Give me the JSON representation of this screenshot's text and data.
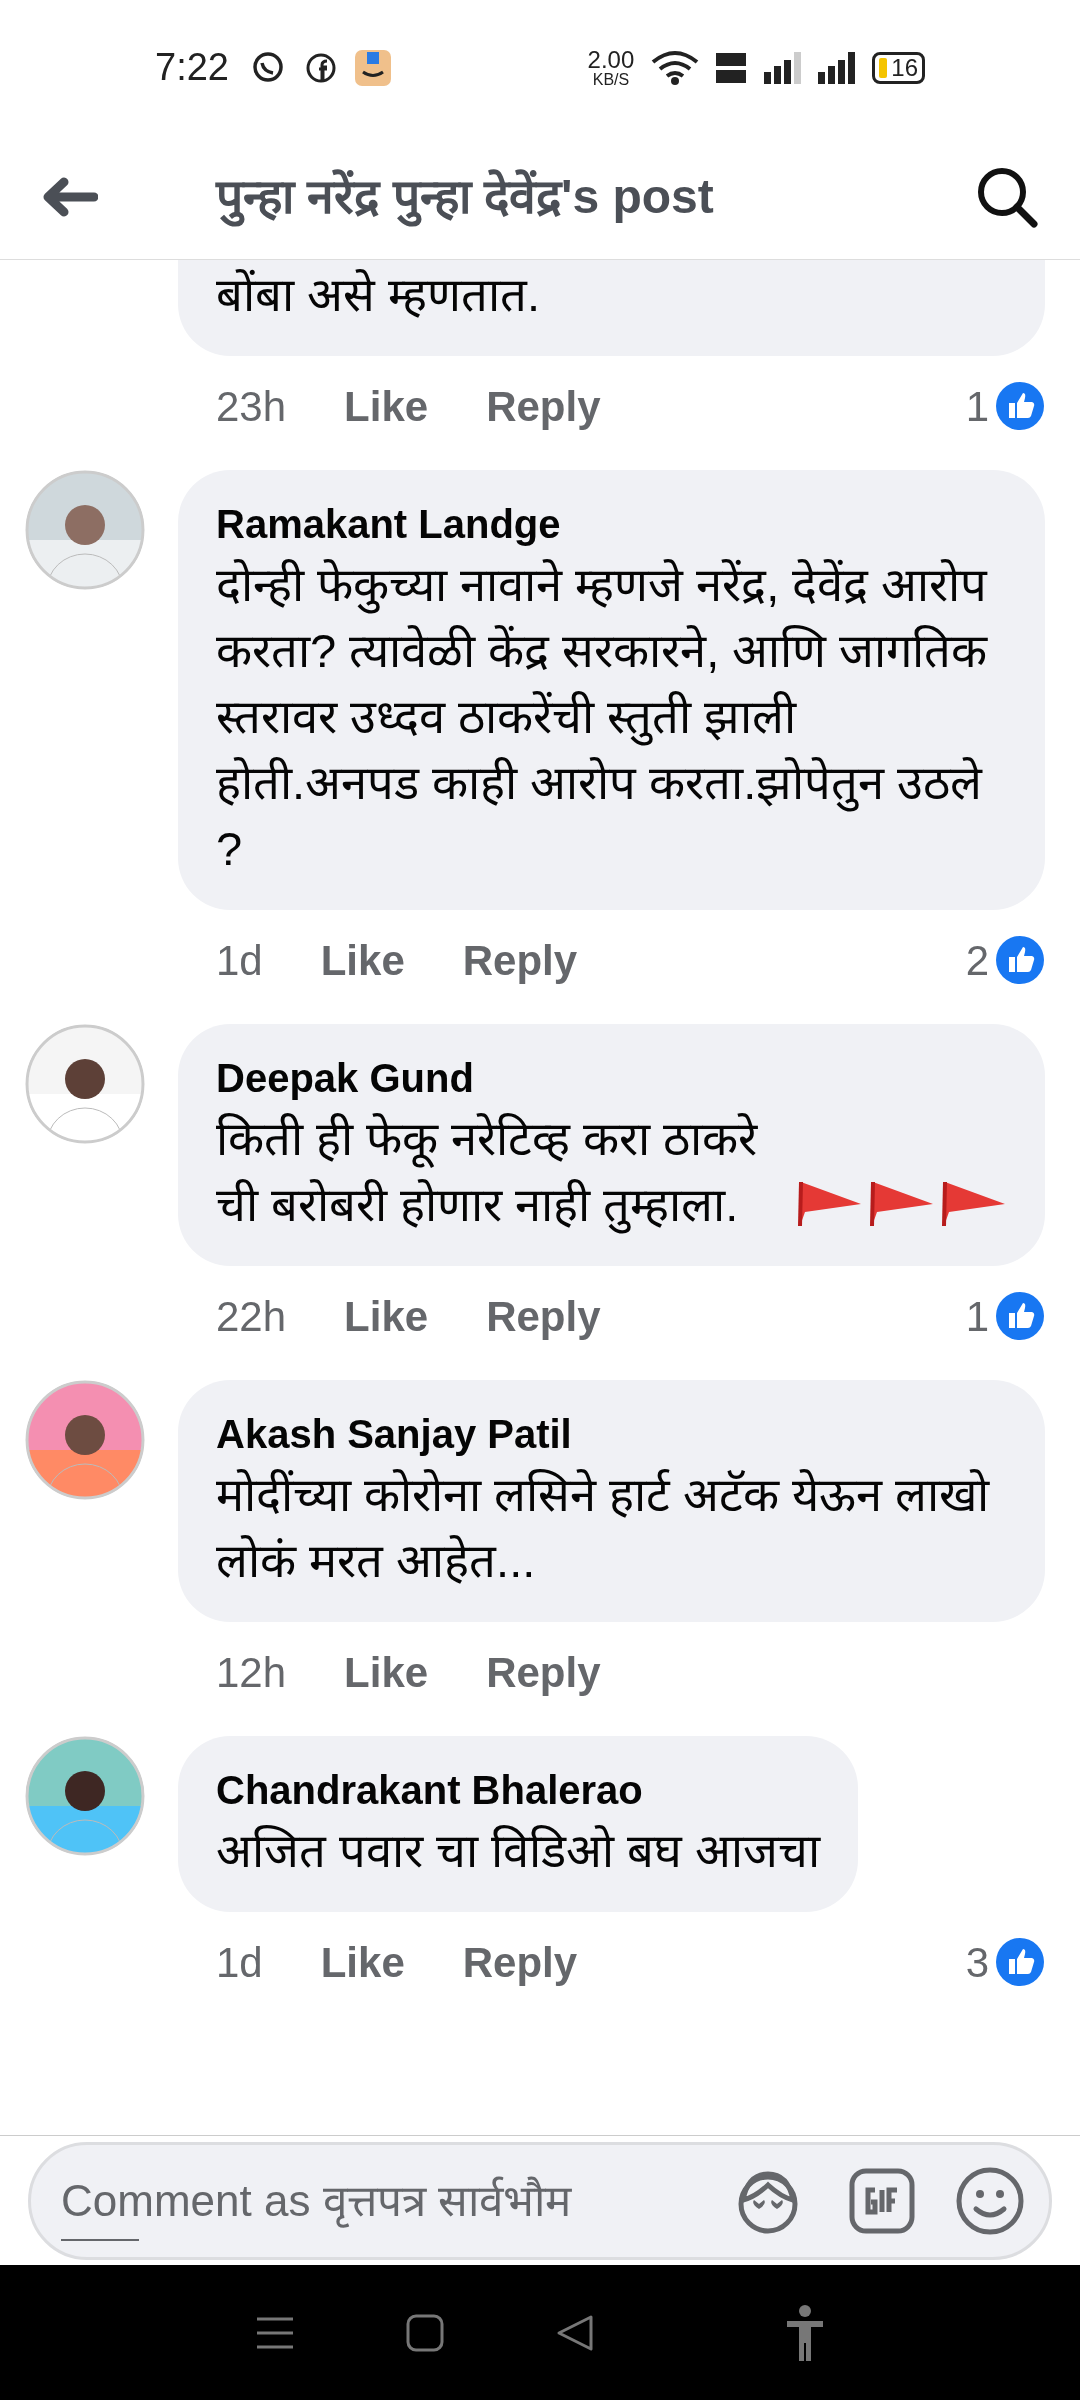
{
  "status_bar": {
    "time": "7:22",
    "speed": "2.00",
    "speed_unit": "KB/S",
    "battery": "16"
  },
  "header": {
    "title": "पुन्हा नरेंद्र पुन्हा देवेंद्र's post"
  },
  "comments": [
    {
      "text": "बोंबा असे म्हणतात.",
      "time": "23h",
      "like": "Like",
      "reply": "Reply",
      "likes": "1",
      "cut_top": true
    },
    {
      "name": "Ramakant Landge",
      "text": "दोन्ही फेकुच्या नावाने म्हणजे नरेंद्र, देवेंद्र आरोप करता? त्यावेळी केंद्र सरकारने, आणि जागतिक स्तरावर उध्दव ठाकरेंची स्तुती झाली होती.अनपड काही आरोप करता.झोपेतुन उठले ?",
      "time": "1d",
      "like": "Like",
      "reply": "Reply",
      "likes": "2",
      "cut_top": false
    },
    {
      "name": "Deepak Gund",
      "text": "किती ही फेकू नरेटिव्ह करा ठाकरे ची बरोबरी होणार नाही तुम्हाला.",
      "trailing_icons": [
        {
          "kind": "flag"
        },
        {
          "kind": "flag"
        },
        {
          "kind": "flag"
        }
      ],
      "time": "22h",
      "like": "Like",
      "reply": "Reply",
      "likes": "1",
      "cut_top": false
    },
    {
      "name": "Akash Sanjay Patil",
      "text": "मोदींच्या कोरोना लसिने हार्ट अटॅक येऊन लाखो लोकं मरत आहेत...",
      "time": "12h",
      "like": "Like",
      "reply": "Reply",
      "cut_top": false
    },
    {
      "name": "Chandrakant Bhalerao",
      "text": "अजित पवार चा विडिओ बघ आजचा",
      "time": "1d",
      "like": "Like",
      "reply": "Reply",
      "likes": "3",
      "cut_top": false
    }
  ],
  "composer": {
    "placeholder": "Comment as वृत्तपत्र सार्वभौम"
  }
}
